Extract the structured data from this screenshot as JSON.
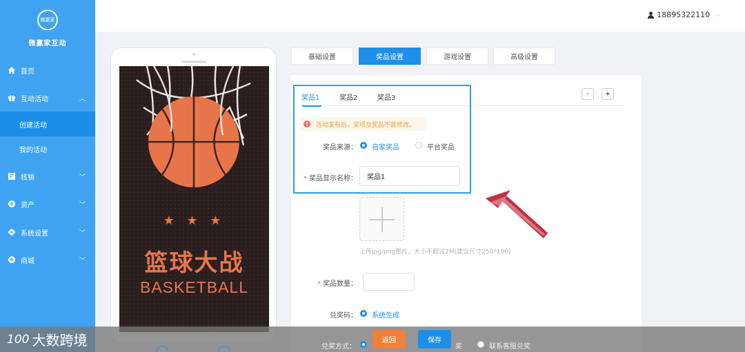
{
  "brand": {
    "logo_text": "微赢家",
    "name": "微赢家互动"
  },
  "sidebar": {
    "items": [
      {
        "label": "首页",
        "icon": "home-icon"
      },
      {
        "label": "互动活动",
        "icon": "gift-icon",
        "chevron": "^"
      },
      {
        "label": "核销",
        "icon": "ticket-icon",
        "chevron": "v"
      },
      {
        "label": "资产",
        "icon": "plus-circle-icon",
        "chevron": "v"
      },
      {
        "label": "系统设置",
        "icon": "gear-icon",
        "chevron": "v"
      },
      {
        "label": "商城",
        "icon": "shop-icon",
        "chevron": "v"
      }
    ],
    "sub_items": [
      {
        "label": "创建活动",
        "active": true
      },
      {
        "label": "我的活动",
        "active": false
      }
    ]
  },
  "header": {
    "user": "18895322110",
    "caret": "⌵"
  },
  "poster": {
    "title": "篮球大战",
    "subtitle": "BASKETBALL",
    "stars": "★ ★ ★"
  },
  "tabs": [
    {
      "label": "基础设置",
      "active": false
    },
    {
      "label": "奖品设置",
      "active": true
    },
    {
      "label": "游戏设置",
      "active": false
    },
    {
      "label": "高级设置",
      "active": false
    }
  ],
  "prize_tabs": [
    {
      "label": "奖品1",
      "active": true
    },
    {
      "label": "奖品2",
      "active": false
    },
    {
      "label": "奖品3",
      "active": false
    }
  ],
  "controls": {
    "minus": "-",
    "plus": "+"
  },
  "alert": {
    "icon": "!",
    "text": "活动发布后，奖项及奖品不能修改。"
  },
  "form": {
    "source_label": "奖品来源：",
    "source_options": [
      {
        "label": "自家奖品",
        "selected": true
      },
      {
        "label": "平台奖品",
        "selected": false
      }
    ],
    "name_label": "奖品显示名称：",
    "name_value": "奖品1",
    "upload_hint": "上传jpg/png图片，大小不超过2M(建议尺寸250*100)",
    "quantity_label": "奖品数量：",
    "quantity_value": "",
    "code_label": "兑奖码：",
    "code_option": "系统生成",
    "method_label": "兑奖方式：",
    "method_partial": "奖",
    "method_option2": "联系客服兑奖"
  },
  "footer": {
    "back": "返回",
    "save": "保存"
  },
  "watermark": {
    "logo": "100",
    "text": "大数跨境"
  },
  "colors": {
    "sidebar": "#3fa3f2",
    "primary": "#1e8fe8",
    "back_button": "#f0803c",
    "arrow": "#c0303f",
    "poster_text": "#e8754a"
  }
}
